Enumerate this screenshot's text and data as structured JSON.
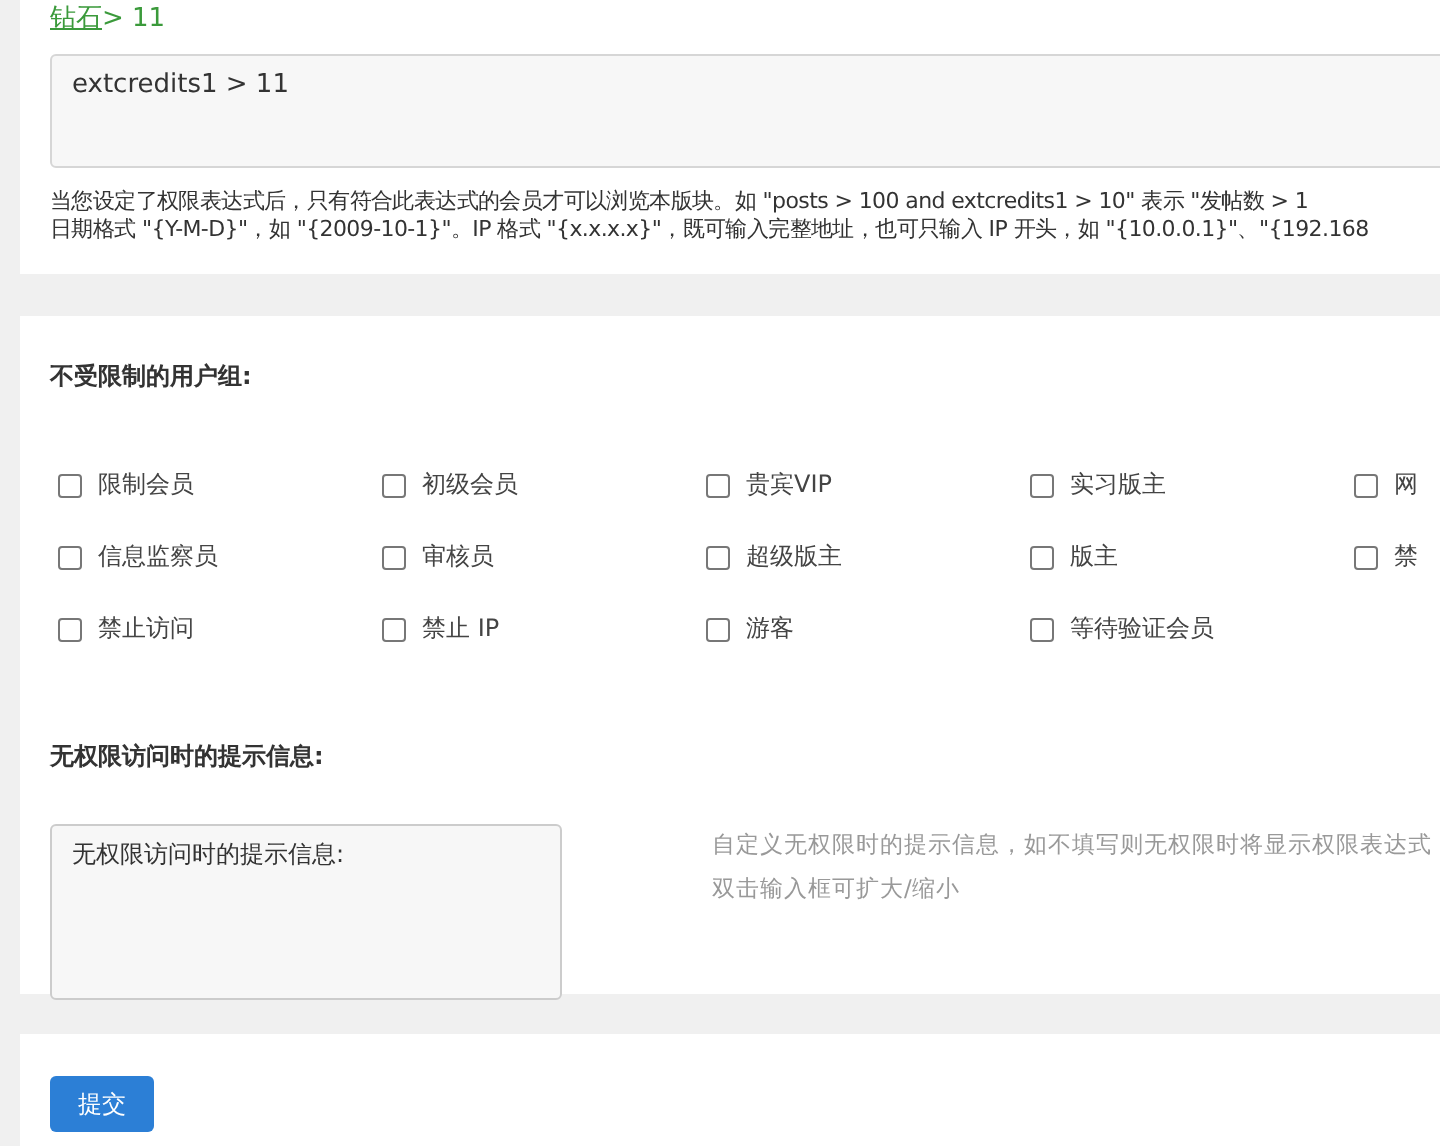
{
  "expression": {
    "link": "钻石",
    "suffix": " > 11",
    "value": "extcredits1 > 11",
    "help": [
      "当您设定了权限表达式后，只有符合此表达式的会员才可以浏览本版块。如 \"posts > 100 and extcredits1 > 10\" 表示 \"发帖数 > 1",
      "日期格式 \"{Y-M-D}\"，如 \"{2009-10-1}\"。IP 格式 \"{x.x.x.x}\"，既可输入完整地址，也可只输入 IP 开头，如 \"{10.0.0.1}\"、\"{192.168"
    ]
  },
  "groups": {
    "title": "不受限制的用户组:",
    "items": [
      {
        "label": "限制会员",
        "checked": false
      },
      {
        "label": "初级会员",
        "checked": false
      },
      {
        "label": "贵宾VIP",
        "checked": false
      },
      {
        "label": "实习版主",
        "checked": false
      },
      {
        "label": "网",
        "checked": false
      },
      {
        "label": "信息监察员",
        "checked": false
      },
      {
        "label": "审核员",
        "checked": false
      },
      {
        "label": "超级版主",
        "checked": false
      },
      {
        "label": "版主",
        "checked": false
      },
      {
        "label": "禁",
        "checked": false
      },
      {
        "label": "禁止访问",
        "checked": false
      },
      {
        "label": "禁止 IP",
        "checked": false
      },
      {
        "label": "游客",
        "checked": false
      },
      {
        "label": "等待验证会员",
        "checked": false
      }
    ]
  },
  "message": {
    "title": "无权限访问时的提示信息:",
    "value": "无权限访问时的提示信息:",
    "hint": [
      "自定义无权限时的提示信息，如不填写则无权限时将显示权限表达式",
      "双击输入框可扩大/缩小"
    ]
  },
  "submit": "提交"
}
